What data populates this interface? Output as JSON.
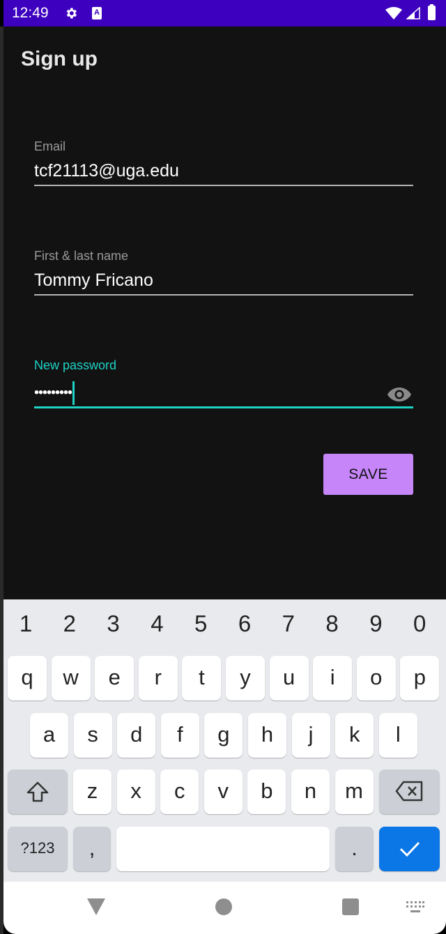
{
  "status_bar": {
    "time": "12:49",
    "icons": [
      "gear-icon",
      "a11y-a-icon",
      "wifi-icon",
      "signal-icon",
      "battery-icon"
    ],
    "a_badge": "A",
    "color": "#3d00bf"
  },
  "page": {
    "title": "Sign up"
  },
  "form": {
    "email": {
      "label": "Email",
      "value": "tcf21113@uga.edu"
    },
    "name": {
      "label": "First & last name",
      "value": "Tommy Fricano"
    },
    "password": {
      "label": "New password",
      "masked_value": "•••••••••",
      "length": 9,
      "focused": true,
      "toggle_icon": "eye-icon"
    },
    "save_label": "SAVE"
  },
  "colors": {
    "accent": "#1dd3c5",
    "button": "#c685f9",
    "background": "#121212",
    "keyboard_action": "#0b76e6"
  },
  "keyboard": {
    "number_row": [
      "1",
      "2",
      "3",
      "4",
      "5",
      "6",
      "7",
      "8",
      "9",
      "0"
    ],
    "row1": [
      "q",
      "w",
      "e",
      "r",
      "t",
      "y",
      "u",
      "i",
      "o",
      "p"
    ],
    "row2": [
      "a",
      "s",
      "d",
      "f",
      "g",
      "h",
      "j",
      "k",
      "l"
    ],
    "row3": [
      "z",
      "x",
      "c",
      "v",
      "b",
      "n",
      "m"
    ],
    "shift_icon": "shift-icon",
    "backspace_icon": "backspace-icon",
    "symbols_label": "?123",
    "comma_label": ",",
    "period_label": ".",
    "done_icon": "check-icon"
  },
  "nav_bar": {
    "icons": [
      "back-icon",
      "home-icon",
      "recents-icon",
      "keyboard-switch-icon"
    ]
  }
}
